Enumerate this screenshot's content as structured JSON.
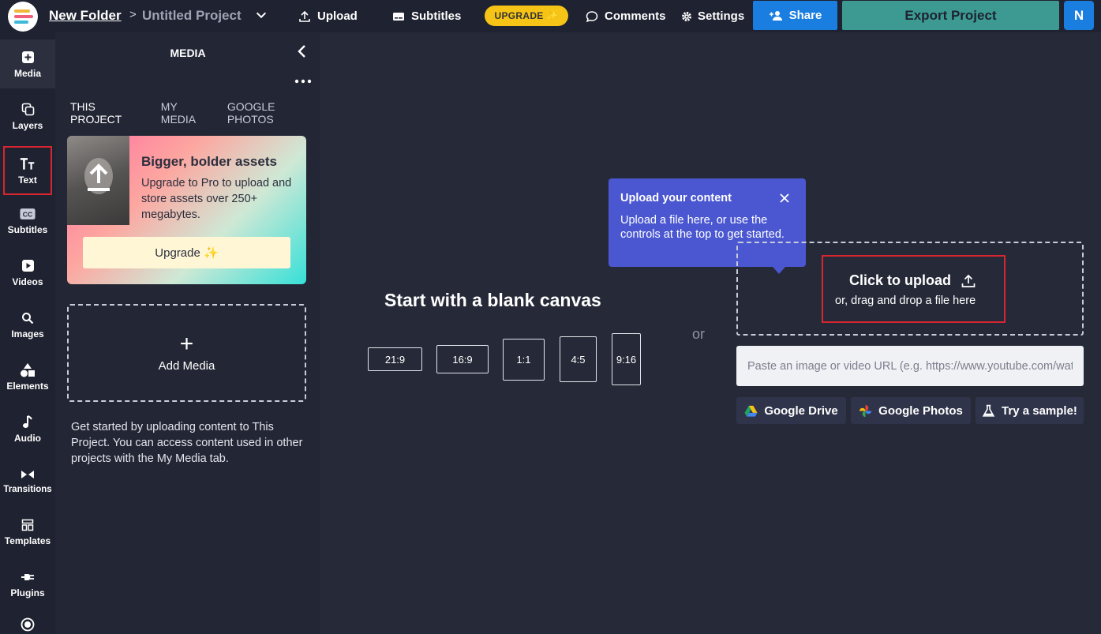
{
  "header": {
    "folder": "New Folder",
    "separator": ">",
    "project": "Untitled Project",
    "upload_label": "Upload",
    "subtitles_label": "Subtitles",
    "upgrade_label": "UPGRADE ✨",
    "comments_label": "Comments",
    "settings_label": "Settings",
    "share_label": "Share",
    "export_label": "Export Project",
    "avatar_initial": "N"
  },
  "rail": {
    "items": [
      {
        "label": "Media",
        "icon": "media-add-icon"
      },
      {
        "label": "Layers",
        "icon": "layers-icon"
      },
      {
        "label": "Text",
        "icon": "text-icon"
      },
      {
        "label": "Subtitles",
        "icon": "cc-icon"
      },
      {
        "label": "Videos",
        "icon": "video-icon"
      },
      {
        "label": "Images",
        "icon": "search-icon"
      },
      {
        "label": "Elements",
        "icon": "shapes-icon"
      },
      {
        "label": "Audio",
        "icon": "music-note-icon"
      },
      {
        "label": "Transitions",
        "icon": "transition-icon"
      },
      {
        "label": "Templates",
        "icon": "templates-icon"
      },
      {
        "label": "Plugins",
        "icon": "plug-icon"
      }
    ]
  },
  "panel": {
    "title": "MEDIA",
    "tabs": [
      "THIS PROJECT",
      "MY MEDIA",
      "GOOGLE PHOTOS"
    ],
    "promo": {
      "title": "Bigger, bolder assets",
      "text": "Upgrade to Pro to upload and store assets over 250+ megabytes.",
      "button": "Upgrade ✨"
    },
    "add_media_label": "Add Media",
    "help_text": "Get started by uploading content to This Project. You can access content used in other projects with the My Media tab."
  },
  "canvas": {
    "blank_title": "Start with a blank canvas",
    "ratios": [
      "21:9",
      "16:9",
      "1:1",
      "4:5",
      "9:16"
    ],
    "or_label": "or"
  },
  "tooltip": {
    "title": "Upload your content",
    "text": "Upload a file here, or use the controls at the top to get started."
  },
  "upload": {
    "click_label": "Click to upload",
    "drag_label": "or, drag and drop a file here",
    "url_placeholder": "Paste an image or video URL (e.g. https://www.youtube.com/watch?v=...)",
    "google_drive_label": "Google Drive",
    "google_photos_label": "Google Photos",
    "sample_label": "Try a sample!"
  },
  "colors": {
    "accent_blue": "#1a7de0",
    "export_teal": "#3c9a92",
    "upgrade_yellow": "#f5c417",
    "tooltip_purple": "#4a57d1",
    "highlight_red": "#d7262f"
  }
}
